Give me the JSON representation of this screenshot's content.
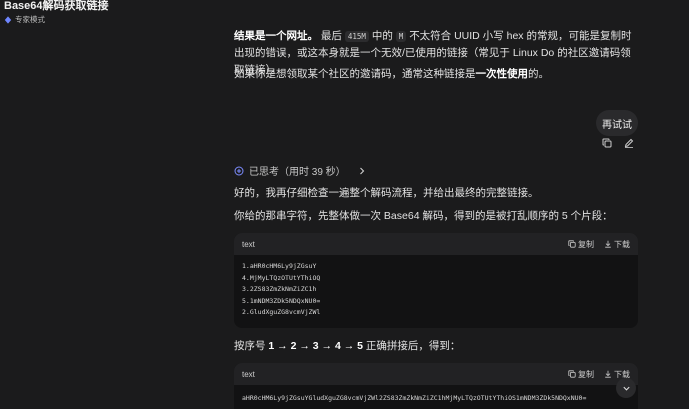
{
  "window": {
    "title": "Base64解码获取链接",
    "mode_label": "专家模式"
  },
  "conversation": {
    "para1_bold": "结果是一个网址。",
    "para1_a": "最后",
    "para1_code1": "415M",
    "para1_b": "中的",
    "para1_code2": "M",
    "para1_c": "不太符合 UUID 小写 hex 的常规，可能是复制时出现的错误，或这本身就是一个无效/已使用的链接（常见于 Linux Do 的社区邀请码领取链接）。",
    "para2_a": "如果你是想领取某个社区的邀请码，通常这种链接是",
    "para2_bold": "一次性使用",
    "para2_b": "的。",
    "retry_label": "再试试",
    "thought_label": "已思考（用时 39 秒）",
    "para3": "好的，我再仔细检查一遍整个解码流程，并给出最终的完整链接。",
    "para4": "你给的那串字符，先整体做一次 Base64 解码，得到的是被打乱顺序的 5 个片段：",
    "para5_a": "按序号",
    "para5_bold": "1 → 2 → 3 → 4 → 5",
    "para5_b": "正确拼接后，得到："
  },
  "code_block_1": {
    "lang": "text",
    "copy_label": "复制",
    "download_label": "下载",
    "lines": [
      "1.aHR0cHM6Ly9jZGsuY",
      "4.MjMyLTQzOTUtYThiOQ",
      "3.2ZS83ZmZkNmZiZC1h",
      "5.1mNDM3ZDk5NDQxNU0=",
      "2.GludXguZG8vcmVjZWl"
    ]
  },
  "code_block_2": {
    "lang": "text",
    "copy_label": "复制",
    "download_label": "下载",
    "lines": [
      "aHR0cHM6Ly9jZGsuYGludXguZG8vcmVjZWl2ZS83ZmZkNmZiZC1hMjMyLTQzOTUtYThiOS1mNDM3ZDk5NDQxNU0="
    ]
  },
  "colors": {
    "background": "#1b1b1c",
    "code_background": "#121213",
    "code_header": "#222224",
    "thought_icon": "#7c8cff"
  },
  "icons": {
    "mode": "expert-mode-icon",
    "copy_message": "copy-icon",
    "edit_message": "edit-icon",
    "thought": "thinking-icon",
    "expand": "chevron-right-icon",
    "copy_code": "copy-icon",
    "download_code": "download-icon",
    "scroll": "chevron-down-icon"
  }
}
